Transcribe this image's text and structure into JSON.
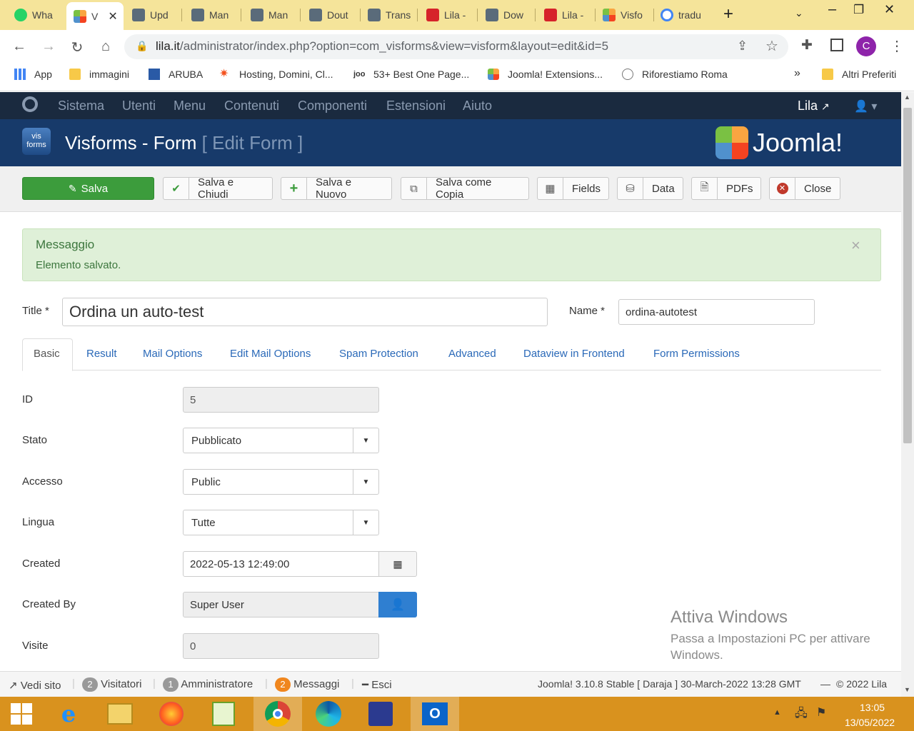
{
  "browser": {
    "tabs": [
      {
        "label": "Wha",
        "icon": "whatsapp-icon"
      },
      {
        "label": "V",
        "icon": "joomla-icon",
        "active": true
      },
      {
        "label": "Upd",
        "icon": "site-thumbnail-icon"
      },
      {
        "label": "Man",
        "icon": "site-thumbnail-icon"
      },
      {
        "label": "Man",
        "icon": "site-thumbnail-icon"
      },
      {
        "label": "Dout",
        "icon": "site-thumbnail-icon"
      },
      {
        "label": "Trans",
        "icon": "site-thumbnail-icon"
      },
      {
        "label": "Lila -",
        "icon": "lila-icon"
      },
      {
        "label": "Dow",
        "icon": "site-thumbnail-icon"
      },
      {
        "label": "Lila -",
        "icon": "lila-icon"
      },
      {
        "label": "Visfo",
        "icon": "joomla-icon"
      },
      {
        "label": "tradu",
        "icon": "google-icon"
      }
    ],
    "url_host": "lila.it",
    "url_path": "/administrator/index.php?option=com_visforms&view=visform&layout=edit&id=5",
    "profile_initial": "C",
    "bookmarks": [
      {
        "label": "App",
        "icon": "apps-grid-icon"
      },
      {
        "label": "immagini",
        "icon": "folder-icon"
      },
      {
        "label": "ARUBA",
        "icon": "aruba-icon"
      },
      {
        "label": "Hosting, Domini, Cl...",
        "icon": "hosting-icon"
      },
      {
        "label": "53+ Best One Page...",
        "icon": "joo-icon"
      },
      {
        "label": "Joomla! Extensions...",
        "icon": "joomla-icon"
      },
      {
        "label": "Riforestiamo Roma",
        "icon": "riforestiamo-icon"
      }
    ],
    "bookmarks_overflow": "»",
    "other_bookmarks": "Altri Preferiti"
  },
  "joomla": {
    "menu": [
      "Sistema",
      "Utenti",
      "Menu",
      "Contenuti",
      "Componenti",
      "Estensioni",
      "Aiuto"
    ],
    "user_link": "Lila",
    "page_title": "Visforms - Form",
    "page_subtitle": "[ Edit Form ]",
    "brand": "Joomla!",
    "component_logo_text": "vis forms",
    "toolbar": [
      {
        "label": "Salva",
        "icon": "edit-icon"
      },
      {
        "label": "Salva e Chiudi",
        "icon": "check-icon"
      },
      {
        "label": "Salva e Nuovo",
        "icon": "plus-icon"
      },
      {
        "label": "Salva come Copia",
        "icon": "copy-icon"
      },
      {
        "label": "Fields",
        "icon": "grid-icon"
      },
      {
        "label": "Data",
        "icon": "drive-icon"
      },
      {
        "label": "PDFs",
        "icon": "file-icon"
      },
      {
        "label": "Close",
        "icon": "cancel-icon"
      }
    ],
    "message": {
      "heading": "Messaggio",
      "text": "Elemento salvato.",
      "close": "×"
    },
    "title_label": "Title *",
    "title_value": "Ordina un auto-test",
    "name_label": "Name *",
    "name_value": "ordina-autotest",
    "tabs": [
      "Basic",
      "Result",
      "Mail Options",
      "Edit Mail Options",
      "Spam Protection",
      "Advanced",
      "Dataview in Frontend",
      "Form Permissions"
    ],
    "fields": {
      "id": {
        "label": "ID",
        "value": "5"
      },
      "stato": {
        "label": "Stato",
        "value": "Pubblicato"
      },
      "accesso": {
        "label": "Accesso",
        "value": "Public"
      },
      "lingua": {
        "label": "Lingua",
        "value": "Tutte"
      },
      "created": {
        "label": "Created",
        "value": "2022-05-13 12:49:00"
      },
      "created_by": {
        "label": "Created By",
        "value": "Super User"
      },
      "visite": {
        "label": "Visite",
        "value": "0"
      }
    },
    "status": {
      "view_site": "Vedi sito",
      "visitors_count": "2",
      "visitors": "Visitatori",
      "admin_count": "1",
      "admin": "Amministratore",
      "messages_count": "2",
      "messages": "Messaggi",
      "logout": "Esci",
      "version": "Joomla! 3.10.8 Stable [ Daraja ] 30-March-2022 13:28 GMT",
      "copyright": "© 2022 Lila"
    }
  },
  "windows": {
    "watermark_title": "Attiva Windows",
    "watermark_line1": "Passa a Impostazioni PC per attivare",
    "watermark_line2": "Windows.",
    "time": "13:05",
    "date": "13/05/2022"
  },
  "colors": {
    "tabstrip": "#f5e49a",
    "joomla_nav": "#1a2a3f",
    "joomla_header": "#173a6a",
    "save_green": "#3c9c3c",
    "message_bg": "#dff0d8",
    "link_blue": "#2a69b8",
    "taskbar": "#d9921e"
  }
}
